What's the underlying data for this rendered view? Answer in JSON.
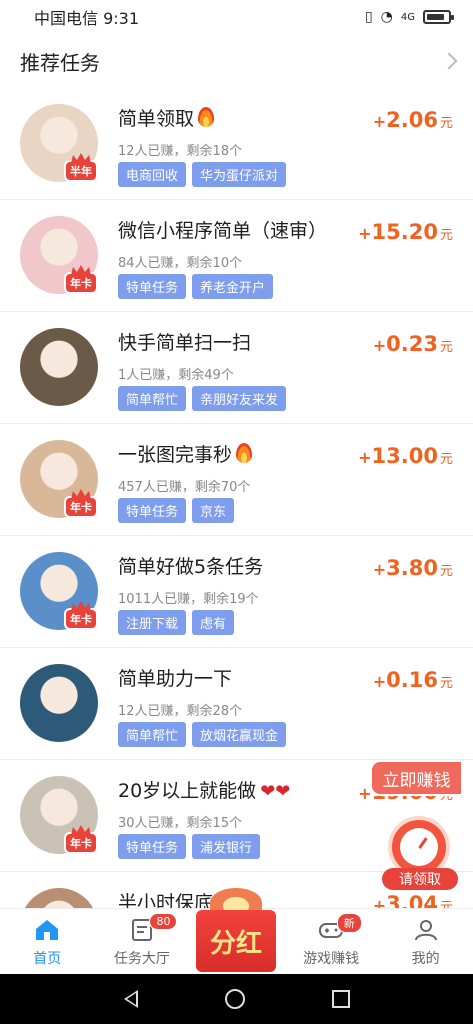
{
  "status": {
    "carrier": "中国电信",
    "time": "9:31",
    "signal": "4G"
  },
  "section": {
    "title": "推荐任务"
  },
  "tasks": [
    {
      "title": "简单领取",
      "title_icon": "flame-icon",
      "meta": "12人已赚，剩余18个",
      "tags": [
        "电商回收",
        "华为蛋仔派对"
      ],
      "reward_plus": "+",
      "reward": "2.06",
      "unit": "元",
      "badge": "半年",
      "avatar_color": "#e8d5c4"
    },
    {
      "title": "微信小程序简单（速审）",
      "title_icon": "",
      "meta": "84人已赚，剩余10个",
      "tags": [
        "特单任务",
        "养老金开户"
      ],
      "reward_plus": "+",
      "reward": "15.20",
      "unit": "元",
      "badge": "年卡",
      "avatar_color": "#f0c8cc"
    },
    {
      "title": "快手简单扫一扫",
      "title_icon": "",
      "meta": "1人已赚，剩余49个",
      "tags": [
        "简单帮忙",
        "亲朋好友来发"
      ],
      "reward_plus": "+",
      "reward": "0.23",
      "unit": "元",
      "badge": "",
      "avatar_color": "#6b5a48"
    },
    {
      "title": "一张图完事秒",
      "title_icon": "flame-icon",
      "meta": "457人已赚，剩余70个",
      "tags": [
        "特单任务",
        "京东"
      ],
      "reward_plus": "+",
      "reward": "13.00",
      "unit": "元",
      "badge": "年卡",
      "avatar_color": "#d9b89a"
    },
    {
      "title": "简单好做5条任务",
      "title_icon": "",
      "meta": "1011人已赚，剩余19个",
      "tags": [
        "注册下载",
        "虑有"
      ],
      "reward_plus": "+",
      "reward": "3.80",
      "unit": "元",
      "badge": "年卡",
      "avatar_color": "#5b8fc9"
    },
    {
      "title": "简单助力一下",
      "title_icon": "",
      "meta": "12人已赚，剩余28个",
      "tags": [
        "简单帮忙",
        "放烟花赢现金"
      ],
      "reward_plus": "+",
      "reward": "0.16",
      "unit": "元",
      "badge": "",
      "avatar_color": "#2d5a78"
    },
    {
      "title": "20岁以上就能做",
      "title_icon": "hearts-icon",
      "title_extra": "❤❤",
      "meta": "30人已赚，剩余15个",
      "tags": [
        "特单任务",
        "浦发银行"
      ],
      "reward_plus": "+",
      "reward": "19.00",
      "unit": "元",
      "badge": "年卡",
      "avatar_color": "#c9c2b5"
    },
    {
      "title": "半小时保底",
      "title_icon": "check-icon",
      "title_extra": "✓",
      "meta": "",
      "tags": [],
      "reward_plus": "+",
      "reward": "3.04",
      "unit": "元",
      "badge": "",
      "avatar_color": "#b98e72"
    }
  ],
  "floating": {
    "earn_now": "立即赚钱",
    "claim": "请领取"
  },
  "tabbar": {
    "items": [
      {
        "label": "首页",
        "icon": "home-icon",
        "active": true,
        "badge": ""
      },
      {
        "label": "任务大厅",
        "icon": "task-list-icon",
        "active": false,
        "badge": "80"
      },
      {
        "label": "分红",
        "icon": "bonus-icon",
        "active": false,
        "badge": ""
      },
      {
        "label": "游戏赚钱",
        "icon": "gamepad-icon",
        "active": false,
        "badge": "新"
      },
      {
        "label": "我的",
        "icon": "user-icon",
        "active": false,
        "badge": ""
      }
    ]
  }
}
